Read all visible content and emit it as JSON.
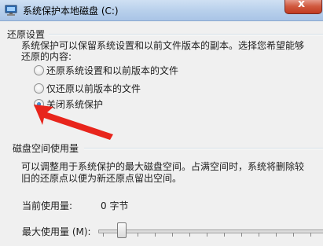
{
  "window": {
    "title": "系统保护本地磁盘 (C:)",
    "close_glyph": "x"
  },
  "restore": {
    "heading": "还原设置",
    "desc_line1": "系统保护可以保留系统设置和以前文件版本的副本。选择您希望能够",
    "desc_line2": "还原的内容:",
    "options": [
      {
        "label": "还原系统设置和以前版本的文件",
        "selected": false
      },
      {
        "label": "仅还原以前版本的文件",
        "selected": false
      },
      {
        "label": "关闭系统保护",
        "selected": true
      }
    ]
  },
  "disk": {
    "heading": "磁盘空间使用量",
    "desc_line1": "可以调整用于系统保护的最大磁盘空间。占满空间时，系统将删除较",
    "desc_line2": "旧的还原点以便为新还原点留出空间。",
    "current_label": "当前使用量:",
    "current_value": "0 字节",
    "max_label": "最大使用量 (M):"
  },
  "annotation": {
    "arrow_color": "#e8251c"
  }
}
